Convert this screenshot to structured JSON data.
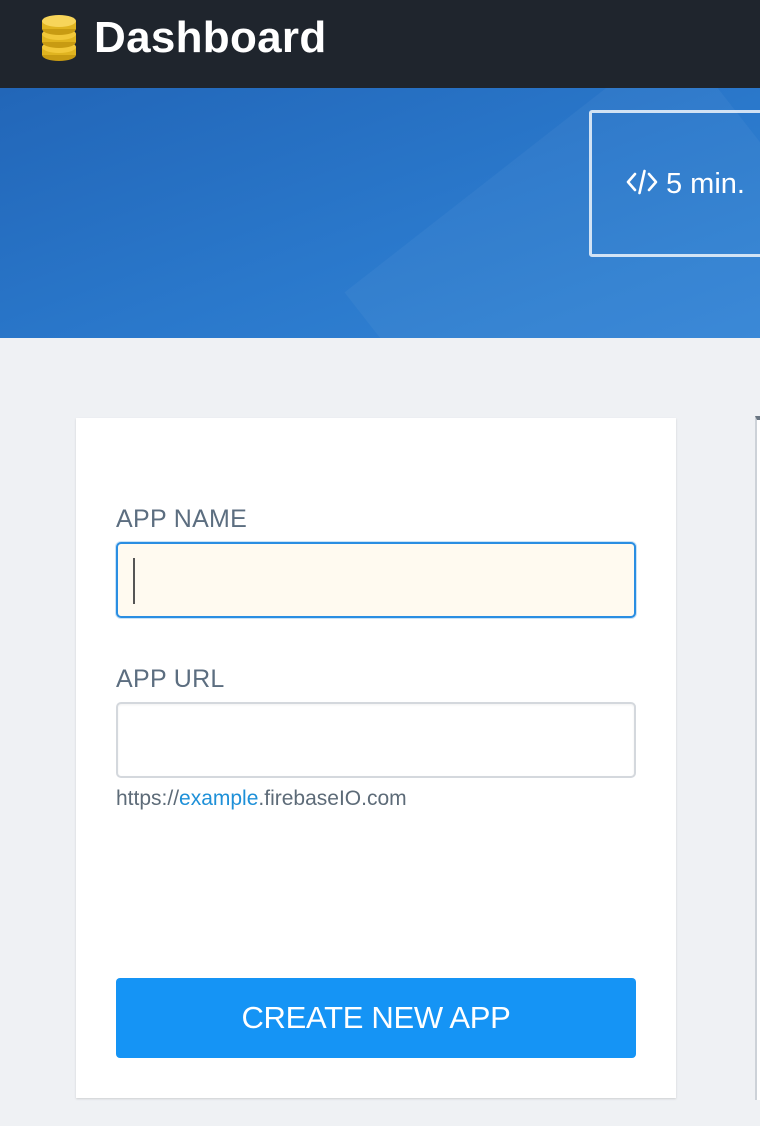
{
  "header": {
    "title": "Dashboard",
    "logo_icon": "database-stack-icon"
  },
  "hero": {
    "quick_card": {
      "icon": "code-icon",
      "label": "5 min."
    }
  },
  "form": {
    "app_name": {
      "label": "APP NAME",
      "value": "",
      "placeholder": ""
    },
    "app_url": {
      "label": "APP URL",
      "value": "",
      "placeholder": ""
    },
    "url_hint": {
      "prefix": "https://",
      "subdomain": "example",
      "suffix": ".firebaseIO.com"
    },
    "create_button": "CREATE NEW APP"
  },
  "colors": {
    "topbar": "#1f252d",
    "hero": "#2a78cb",
    "accent": "#1594f5",
    "link": "#1e90d8",
    "label": "#5c6e80"
  }
}
